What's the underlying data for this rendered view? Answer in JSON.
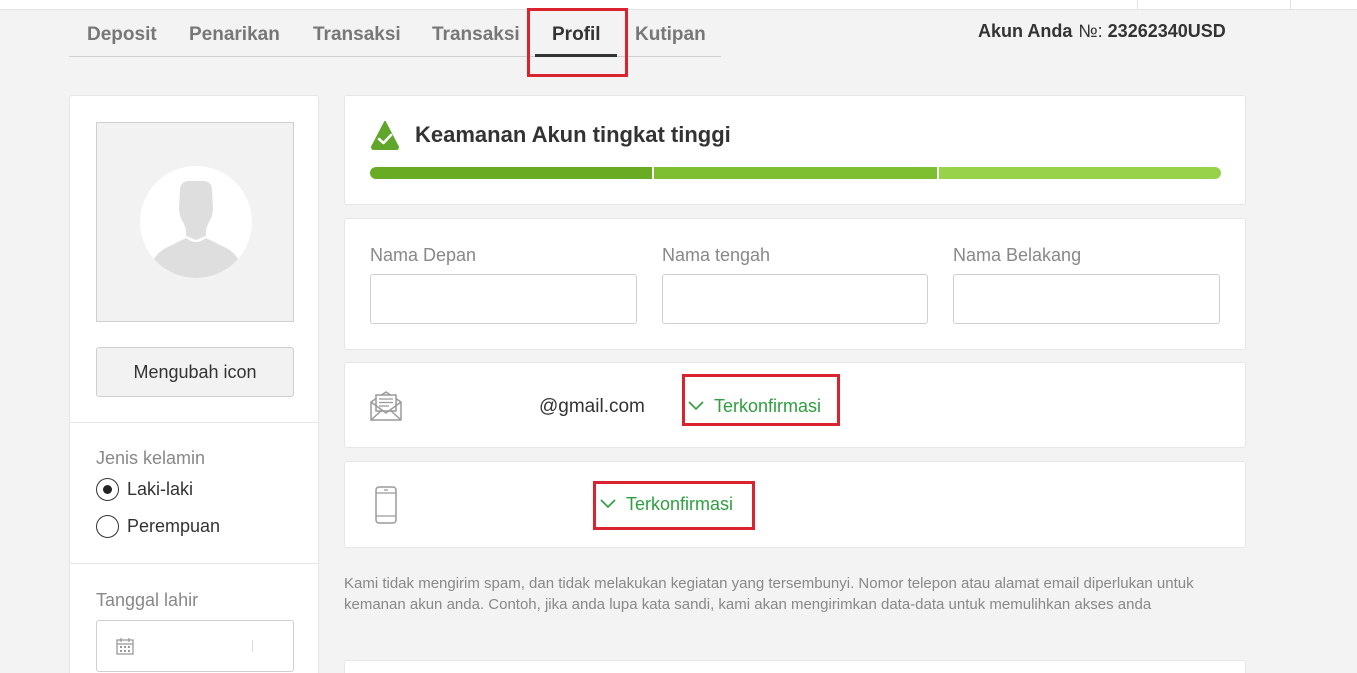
{
  "tabs": [
    {
      "label": "Deposit",
      "active": false
    },
    {
      "label": "Penarikan",
      "active": false
    },
    {
      "label": "Transaksi",
      "active": false
    },
    {
      "label": "Transaksi",
      "active": false
    },
    {
      "label": "Profil",
      "active": true
    },
    {
      "label": "Kutipan",
      "active": false
    }
  ],
  "account": {
    "label": "Akun Anda",
    "number_sign": "№:",
    "number": "23262340USD"
  },
  "sidebar": {
    "avatar_icon": "user-silhouette-icon",
    "change_icon_label": "Mengubah icon",
    "gender_label": "Jenis kelamin",
    "gender_options": [
      {
        "label": "Laki-laki",
        "selected": true
      },
      {
        "label": "Perempuan",
        "selected": false
      }
    ],
    "birthdate_label": "Tanggal lahir",
    "birthdate_value": "",
    "calendar_icon": "calendar-icon"
  },
  "security": {
    "title": "Keamanan Akun tingkat tinggi",
    "icon": "shield-check-icon",
    "level": 1.0,
    "segment_colors": [
      "#6aab24",
      "#7dbf31",
      "#98d14a"
    ]
  },
  "name_fields": {
    "first_name_label": "Nama Depan",
    "middle_name_label": "Nama tengah",
    "last_name_label": "Nama Belakang",
    "first_name_value": "",
    "middle_name_value": "",
    "last_name_value": ""
  },
  "email": {
    "icon": "envelope-icon",
    "value": "@gmail.com",
    "status": "Terkonfirmasi"
  },
  "phone": {
    "icon": "smartphone-icon",
    "value": "",
    "status": "Terkonfirmasi"
  },
  "note": "Kami tidak mengirim spam, dan tidak melakukan kegiatan yang tersembunyi. Nomor telepon atau alamat email diperlukan untuk kemanan akun anda. Contoh, jika anda lupa kata sandi, kami akan mengirimkan data-data untuk memulihkan akses anda",
  "colors": {
    "confirmed": "#2e9e3e",
    "highlight": "#d9232e",
    "background": "#f3f3f3"
  }
}
